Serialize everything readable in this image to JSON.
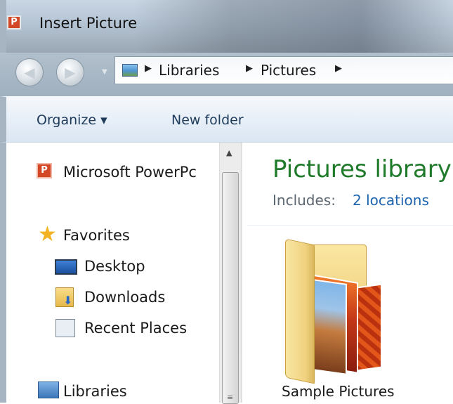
{
  "window": {
    "title": "Insert Picture",
    "app_icon": "powerpoint-icon"
  },
  "navigation": {
    "back_icon": "back-arrow-icon",
    "forward_icon": "forward-arrow-icon",
    "breadcrumbs": [
      "Libraries",
      "Pictures"
    ]
  },
  "toolbar": {
    "organize_label": "Organize ▾",
    "new_folder_label": "New folder"
  },
  "sidebar": {
    "items": [
      {
        "label": "Microsoft PowerPc",
        "icon": "powerpoint-icon"
      },
      {
        "label": "Favorites",
        "icon": "star-icon"
      },
      {
        "label": "Desktop",
        "icon": "desktop-icon"
      },
      {
        "label": "Downloads",
        "icon": "downloads-icon"
      },
      {
        "label": "Recent Places",
        "icon": "recent-places-icon"
      },
      {
        "label": "Libraries",
        "icon": "libraries-icon"
      }
    ]
  },
  "library": {
    "title": "Pictures library",
    "includes_label": "Includes:",
    "includes_link": "2 locations"
  },
  "items": [
    {
      "name": "Sample Pictures",
      "icon": "folder-icon"
    }
  ],
  "colors": {
    "title_green": "#1f7a2a",
    "link_blue": "#1e63ae",
    "powerpoint_orange": "#d24726",
    "star_gold": "#f2b222"
  }
}
